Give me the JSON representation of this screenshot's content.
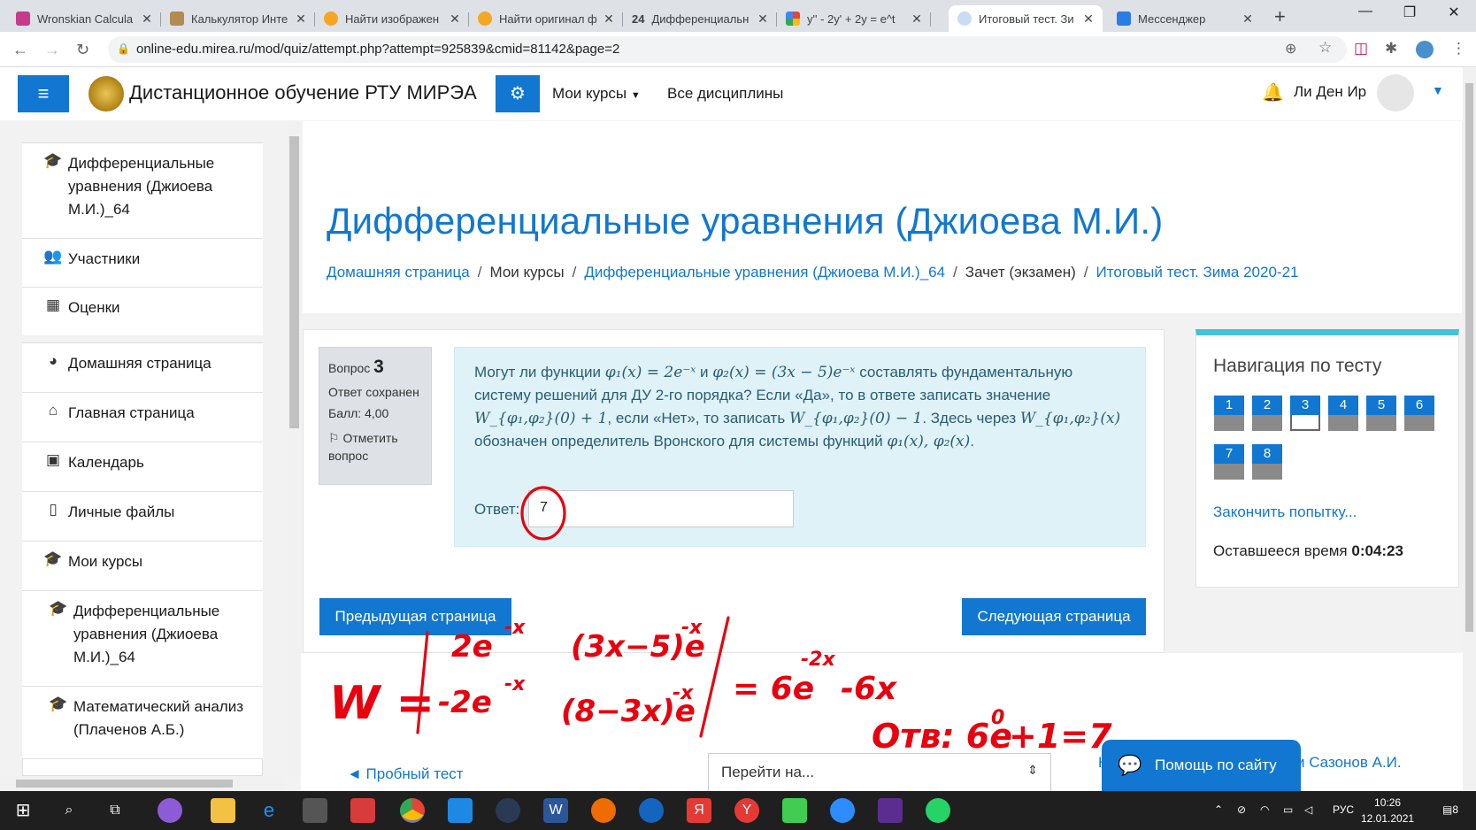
{
  "browser": {
    "tabs": [
      {
        "label": "Wronskian Calcula",
        "color": "#c43b8c"
      },
      {
        "label": "Калькулятор Инте",
        "color": "#b28b52"
      },
      {
        "label": "Найти изображен",
        "color": "#f5a623"
      },
      {
        "label": "Найти оригинал ф",
        "color": "#f5a623"
      },
      {
        "label": "Дифференциальн",
        "color": "#444444"
      },
      {
        "label": "y'' - 2y' + 2y = e^t",
        "color": "#4285f4"
      },
      {
        "label": "Итоговый тест. Зи",
        "color": "#7aa6d8"
      },
      {
        "label": "Мессенджер",
        "color": "#2a7ce6"
      }
    ],
    "tab5_badge": "24",
    "url": "online-edu.mirea.ru/mod/quiz/attempt.php?attempt=925839&cmid=81142&page=2"
  },
  "header": {
    "site_name": "Дистанционное обучение РТУ МИРЭА",
    "nav": [
      "Мои курсы",
      "Все дисциплины"
    ],
    "user": "Ли Ден Ир"
  },
  "sidebar": {
    "items": [
      {
        "icon": "graduation-cap-icon",
        "glyph": "🎓",
        "label": "Дифференциальные уравнения (Джиоева М.И.)_64"
      },
      {
        "icon": "users-icon",
        "glyph": "👥",
        "label": "Участники"
      },
      {
        "icon": "table-icon",
        "glyph": "▦",
        "label": "Оценки"
      },
      {
        "icon": "dashboard-icon",
        "glyph": "◕",
        "label": "Домашняя страница"
      },
      {
        "icon": "home-icon",
        "glyph": "⌂",
        "label": "Главная страница"
      },
      {
        "icon": "calendar-icon",
        "glyph": "▣",
        "label": "Календарь"
      },
      {
        "icon": "file-icon",
        "glyph": "▯",
        "label": "Личные файлы"
      },
      {
        "icon": "graduation-cap-icon",
        "glyph": "🎓",
        "label": "Мои курсы"
      },
      {
        "icon": "graduation-cap-icon",
        "glyph": "🎓",
        "label": "Дифференциальные уравнения (Джиоева М.И.)_64"
      },
      {
        "icon": "graduation-cap-icon",
        "glyph": "🎓",
        "label": "Математический анализ (Плаченов А.Б.)"
      }
    ]
  },
  "page": {
    "title": "Дифференциальные уравнения (Джиоева М.И.)",
    "breadcrumbs": [
      {
        "label": "Домашняя страница",
        "link": true
      },
      {
        "label": "Мои курсы",
        "link": false
      },
      {
        "label": "Дифференциальные уравнения (Джиоева М.И.)_64",
        "link": true
      },
      {
        "label": "Зачет (экзамен)",
        "link": false
      },
      {
        "label": "Итоговый тест. Зима 2020-21",
        "link": true
      }
    ]
  },
  "question": {
    "label": "Вопрос",
    "number": "3",
    "status": "Ответ сохранен",
    "score": "Балл: 4,00",
    "flag": "Отметить вопрос",
    "text_1": "Могут ли функции",
    "phi1": "φ₁(x) = 2e⁻ˣ",
    "and": "и",
    "phi2": "φ₂(x) = (3x − 5)e⁻ˣ",
    "text_2": "составлять фундаментальную систему решений для ДУ 2-го порядка? Если «Да», то в ответе записать значение",
    "w_plus": "W_{φ₁,φ₂}(0) + 1",
    "text_3": ", если «Нет», то записать",
    "w_minus": "W_{φ₁,φ₂}(0) − 1",
    "text_4": ". Здесь через",
    "w_x": "W_{φ₁,φ₂}(x)",
    "text_5": "обозначен определитель Вронского для системы функций",
    "phis": "φ₁(x), φ₂(x)",
    "text_6": ".",
    "answer_label": "Ответ:",
    "answer_value": "7"
  },
  "buttons": {
    "prev_page": "Предыдущая страница",
    "next_page": "Следующая страница"
  },
  "quiz_nav": {
    "title": "Навигация по тесту",
    "questions": [
      "1",
      "2",
      "3",
      "4",
      "5",
      "6",
      "7",
      "8"
    ],
    "finish": "Закончить попытку...",
    "time_label": "Оставшееся время",
    "time_value": "0:04:23"
  },
  "footer": {
    "prev_test": "◄ Пробный тест",
    "jump_placeholder": "Перейти на...",
    "help": "Помощь по сайту",
    "next_fragment_left": "К",
    "next_fragment_right": "и Сазонов А.И."
  },
  "handwriting": {
    "w": "W =",
    "m11": "2e",
    "m11_exp": "-x",
    "m12": "(3x−5)e",
    "m12_exp": "-x",
    "m21": "-2e",
    "m21_exp": "-x",
    "m22": "(8−3x)e",
    "m22_exp": "-x",
    "rhs": "= 6e",
    "rhs_exp": "-2x",
    "rhs_tail": "-6x",
    "answer": "Отв: 6e",
    "answer_exp": "0",
    "answer_tail": "+1=7",
    "ink_color": "#e8000e"
  },
  "taskbar": {
    "lang": "РУС",
    "time": "10:26",
    "date": "12.01.2021",
    "notif": "8"
  }
}
